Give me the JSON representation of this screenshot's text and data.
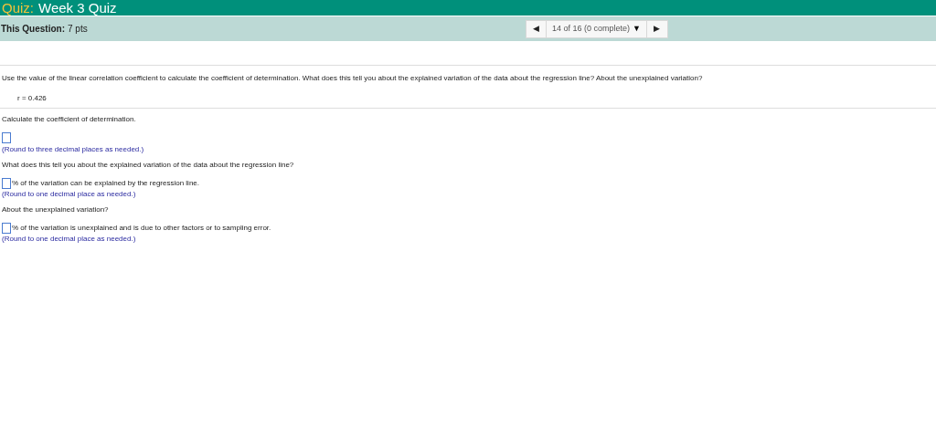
{
  "header": {
    "title_prefix": "Quiz:",
    "title": "Week 3 Quiz"
  },
  "question_bar": {
    "label": "This Question:",
    "points": "7 pts",
    "prev": "◀",
    "position": "14 of 16 (0 complete)",
    "dropdown": "▼",
    "next": "▶"
  },
  "question": {
    "text": "Use the value of the linear correlation coefficient to calculate the coefficient of determination. What does this tell you about the explained variation of the data about the regression line? About the unexplained variation?",
    "given": "r = 0.426"
  },
  "parts": [
    {
      "prompt": "Calculate the coefficient of determination.",
      "kind": "block",
      "hint": "(Round to three decimal places as needed.)"
    },
    {
      "prompt": "What does this tell you about the explained variation of the data about the regression line?",
      "kind": "inline",
      "suffix": "% of the variation can be explained by the regression line.",
      "hint": "(Round to one decimal place as needed.)"
    },
    {
      "prompt": "About the unexplained variation?",
      "kind": "inline",
      "suffix": "% of the variation is unexplained and is due to other factors or to sampling error.",
      "hint": "(Round to one decimal place as needed.)"
    }
  ]
}
